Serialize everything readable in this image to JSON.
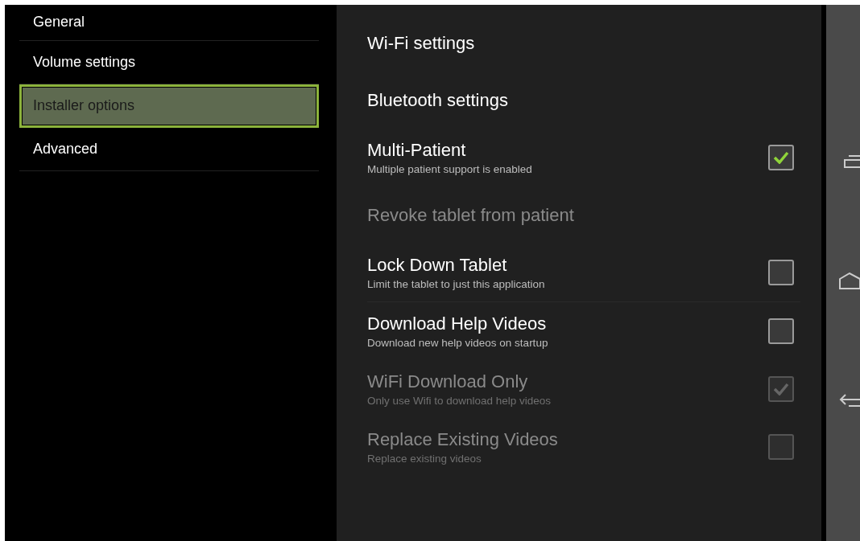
{
  "sidebar": {
    "items": [
      {
        "label": "General",
        "selected": false
      },
      {
        "label": "Volume settings",
        "selected": false
      },
      {
        "label": "Installer options",
        "selected": true
      },
      {
        "label": "Advanced",
        "selected": false
      }
    ]
  },
  "settings": [
    {
      "kind": "link",
      "title": "Wi-Fi settings",
      "disabled": false
    },
    {
      "kind": "link",
      "title": "Bluetooth settings",
      "disabled": false
    },
    {
      "kind": "checkbox",
      "title": "Multi-Patient",
      "summary": "Multiple patient support is enabled",
      "checked": true,
      "disabled": false
    },
    {
      "kind": "link",
      "title": "Revoke tablet from patient",
      "disabled": true
    },
    {
      "kind": "checkbox",
      "title": "Lock Down Tablet",
      "summary": "Limit the tablet to just this application",
      "checked": false,
      "disabled": false
    },
    {
      "kind": "checkbox",
      "title": "Download Help Videos",
      "summary": "Download new help videos on startup",
      "checked": false,
      "disabled": false
    },
    {
      "kind": "checkbox",
      "title": "WiFi Download Only",
      "summary": "Only use Wifi to download help videos",
      "checked": true,
      "disabled": true
    },
    {
      "kind": "checkbox",
      "title": "Replace Existing Videos",
      "summary": "Replace existing videos",
      "checked": false,
      "disabled": true
    }
  ]
}
